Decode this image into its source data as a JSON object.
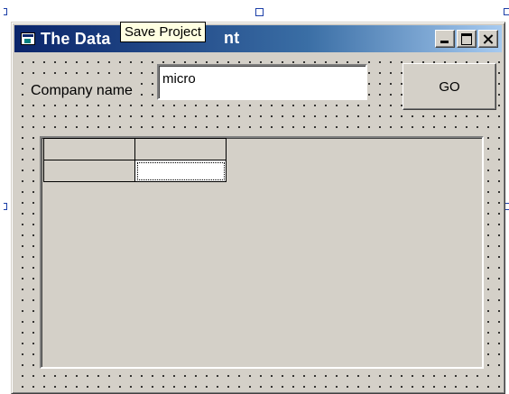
{
  "window": {
    "title_start": "The Data",
    "title_end": "nt",
    "tooltip": "Save Project"
  },
  "form": {
    "company_label": "Company name",
    "company_value": "micro",
    "go_label": "GO"
  },
  "grid": {
    "rows": [
      [
        "",
        ""
      ],
      [
        "",
        ""
      ]
    ]
  },
  "colors": {
    "titlebar_start": "#0a246a",
    "titlebar_end": "#a6caf0",
    "face": "#d4d0c8",
    "tooltip_bg": "#ffffe1"
  },
  "icons": [
    "app-icon",
    "minimize-icon",
    "maximize-icon",
    "close-icon",
    "resize-handle-icon"
  ]
}
